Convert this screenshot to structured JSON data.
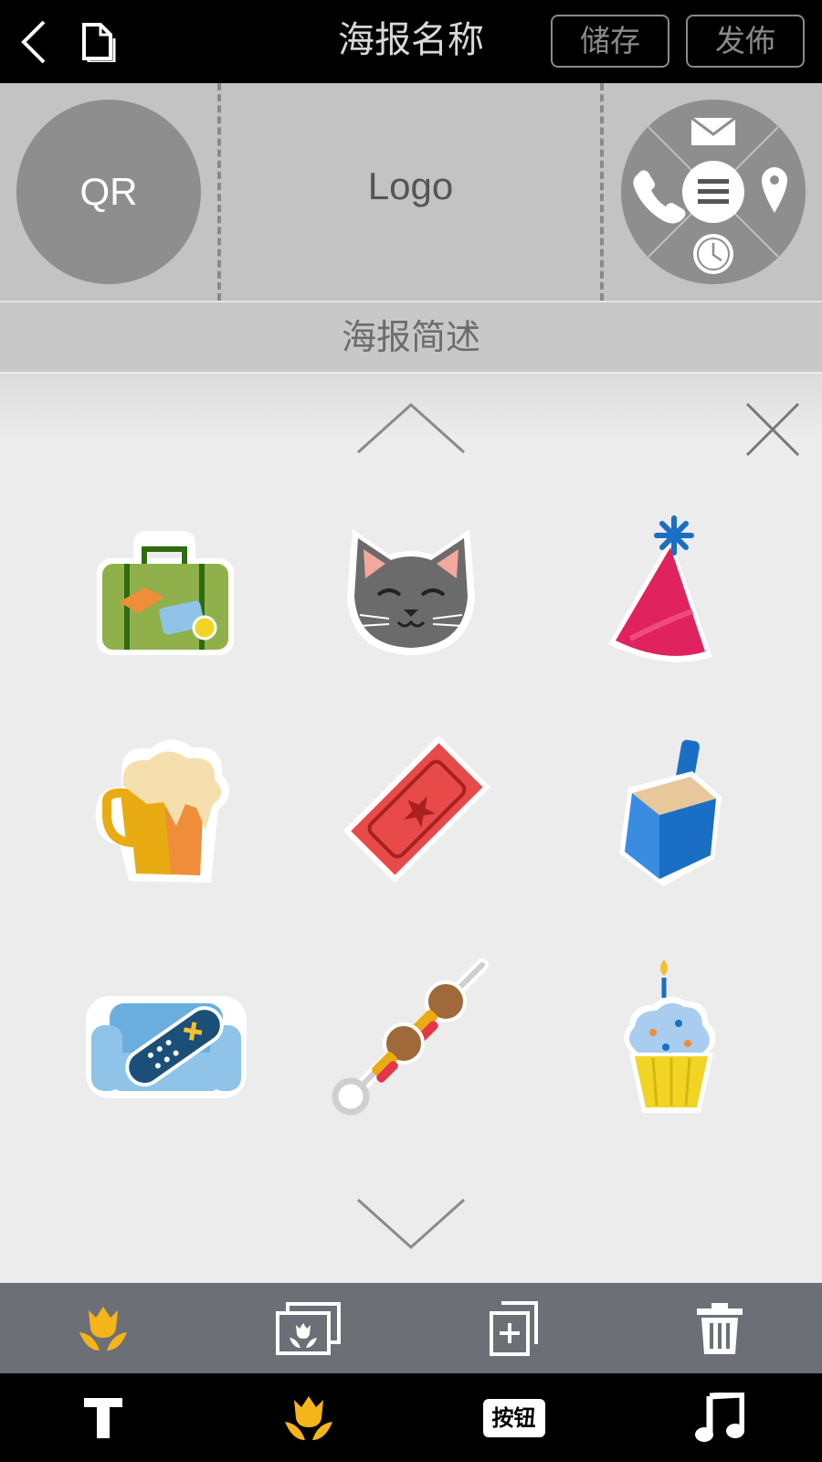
{
  "header": {
    "title": "海报名称",
    "save_label": "储存",
    "publish_label": "发佈",
    "back_icon": "chevron-left-icon",
    "doc_icon": "document-icon"
  },
  "poster": {
    "qr_label": "QR",
    "logo_label": "Logo",
    "description": "海报简述",
    "contact_icons": [
      "mail-icon",
      "phone-icon",
      "menu-icon",
      "location-icon",
      "clock-icon"
    ]
  },
  "stickers": [
    {
      "name": "suitcase"
    },
    {
      "name": "cat-face"
    },
    {
      "name": "party-hat"
    },
    {
      "name": "beer-mug"
    },
    {
      "name": "ticket"
    },
    {
      "name": "dreidel"
    },
    {
      "name": "sofa-bandage"
    },
    {
      "name": "kebab-skewer"
    },
    {
      "name": "cupcake"
    }
  ],
  "toolbar_primary": [
    "sticker-icon",
    "gallery-icon",
    "duplicate-icon",
    "trash-icon"
  ],
  "toolbar_secondary": {
    "text_icon": "T",
    "button_label": "按钮",
    "music_icon": "music-note-icon"
  },
  "colors": {
    "accent": "#f5b418",
    "toolbar": "#6c6f76",
    "panel": "#ececec"
  }
}
